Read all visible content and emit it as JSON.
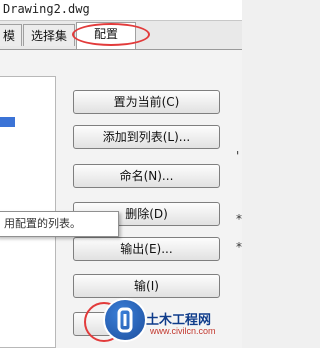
{
  "window": {
    "title": "Drawing2.dwg"
  },
  "tabs": [
    {
      "label": "模"
    },
    {
      "label": "选择集"
    },
    {
      "label": "配置"
    }
  ],
  "buttons": {
    "set_current": "置为当前(C)",
    "add_to_list": "添加到列表(L)...",
    "rename": "命名(N)...",
    "delete": "删除(D)",
    "export": "输出(E)...",
    "import": "输(I)"
  },
  "tooltip": {
    "text": "用配置的列表。"
  },
  "edge_marks": [
    "'",
    "*",
    "*"
  ],
  "watermark": {
    "brand": "土木工程网",
    "url": "www.civilcn.com"
  },
  "colors": {
    "highlight_ellipse": "#e23b3b",
    "selection": "#3b73d6"
  }
}
